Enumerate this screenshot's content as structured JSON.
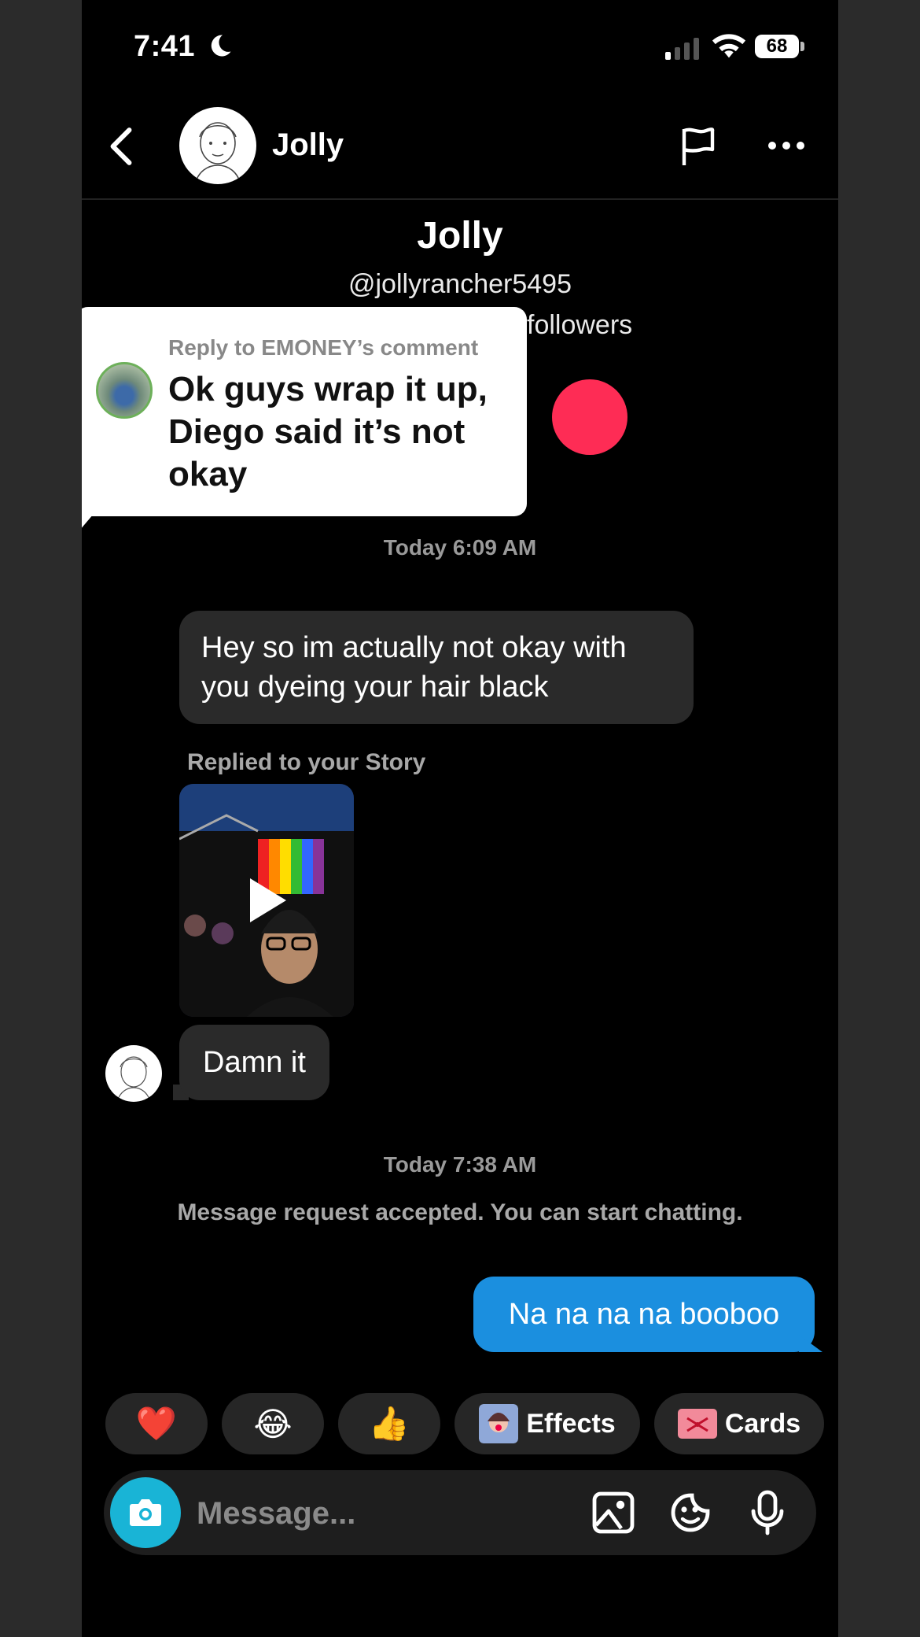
{
  "status_bar": {
    "time": "7:41",
    "battery": "68"
  },
  "header": {
    "name": "Jolly"
  },
  "profile": {
    "name": "Jolly",
    "handle": "@jollyrancher5495",
    "followers_suffix": "followers"
  },
  "reply_card": {
    "label": "Reply to EMONEY’s comment",
    "text": "Ok guys wrap it up, Diego said it’s not okay"
  },
  "conversation": {
    "timestamp_1": "Today 6:09 AM",
    "message_1": "Hey so im actually not okay with you dyeing your hair black",
    "replied_label": "Replied to your Story",
    "message_2": "Damn it",
    "timestamp_2": "Today 7:38 AM",
    "request_notice": "Message request accepted. You can start chatting.",
    "outgoing_message": "Na na na na booboo"
  },
  "quick_replies": {
    "heart": "❤️",
    "laugh": "😂",
    "thumbs": "👍",
    "effects_label": "Effects",
    "cards_label": "Cards"
  },
  "composer": {
    "placeholder": "Message..."
  },
  "colors": {
    "accent_blue": "#1b8fdf",
    "camera_teal": "#19b4d6",
    "tiktok_pink": "#fe2c55"
  }
}
